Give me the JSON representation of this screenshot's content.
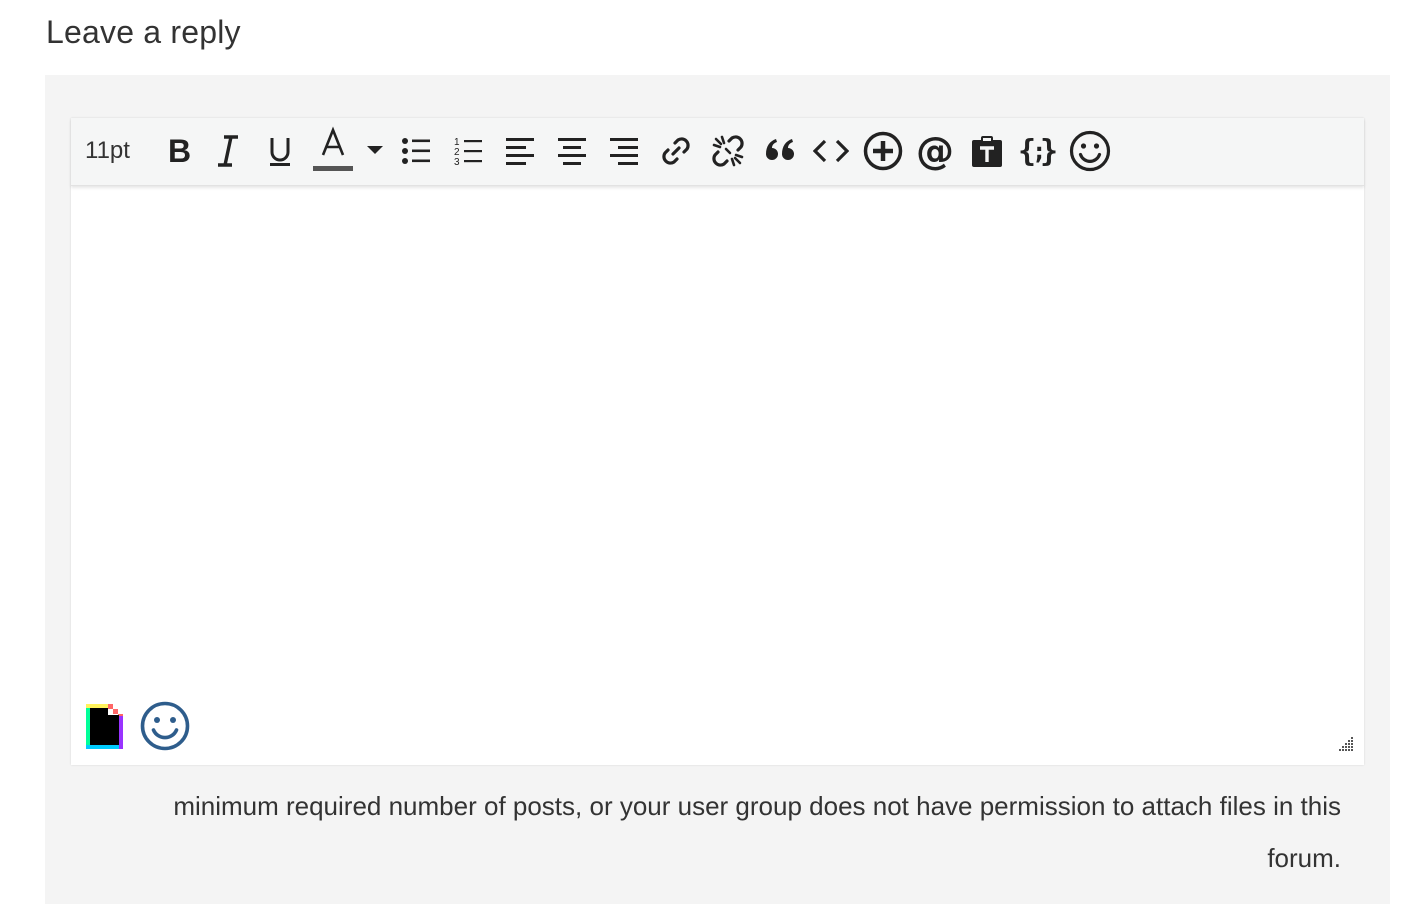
{
  "reply": {
    "heading": "Leave a reply"
  },
  "toolbar": {
    "font_size": "11pt",
    "text_color": "#555555",
    "buttons": [
      {
        "name": "bold-icon"
      },
      {
        "name": "italic-icon"
      },
      {
        "name": "underline-icon"
      },
      {
        "name": "text-color-icon"
      },
      {
        "name": "dropdown-caret-icon"
      },
      {
        "name": "bullet-list-icon"
      },
      {
        "name": "numbered-list-icon"
      },
      {
        "name": "align-left-icon"
      },
      {
        "name": "align-center-icon"
      },
      {
        "name": "align-right-icon"
      },
      {
        "name": "link-icon"
      },
      {
        "name": "unlink-icon"
      },
      {
        "name": "blockquote-icon"
      },
      {
        "name": "code-icon"
      },
      {
        "name": "add-icon"
      },
      {
        "name": "mention-icon"
      },
      {
        "name": "paste-text-icon"
      },
      {
        "name": "code-sample-icon"
      },
      {
        "name": "emoji-icon"
      }
    ]
  },
  "editor": {
    "bottom_icons": [
      "giphy-icon",
      "smiley-icon"
    ],
    "accent_color": "#2e5d8c"
  },
  "notice": {
    "line1": "minimum required number of posts, or your user group does not have permission to attach files in this",
    "line2": "forum."
  }
}
